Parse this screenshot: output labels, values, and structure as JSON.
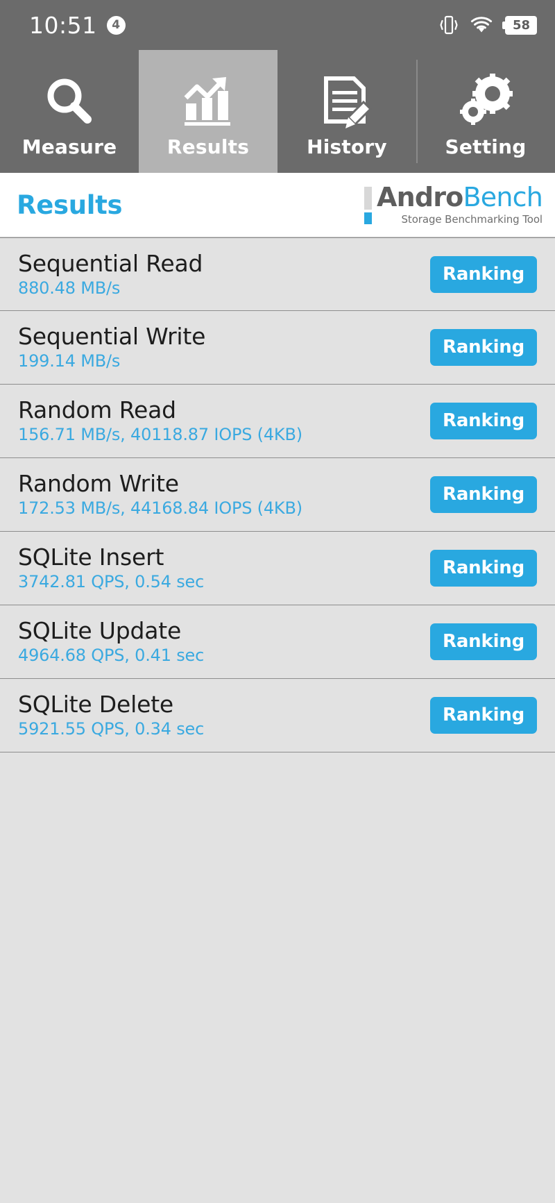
{
  "status_bar": {
    "time": "10:51",
    "notification_count": "4",
    "battery_level": "58",
    "icons": [
      "vibrate-icon",
      "wifi-icon",
      "battery-icon"
    ]
  },
  "tabs": [
    {
      "label": "Measure",
      "icon": "magnifier-icon",
      "active": false
    },
    {
      "label": "Results",
      "icon": "bar-chart-icon",
      "active": true
    },
    {
      "label": "History",
      "icon": "document-pencil-icon",
      "active": false
    },
    {
      "label": "Setting",
      "icon": "gears-icon",
      "active": false
    }
  ],
  "header": {
    "page_title": "Results",
    "brand_primary": "Andro",
    "brand_secondary": "Bench",
    "brand_tagline": "Storage Benchmarking Tool"
  },
  "colors": {
    "accent_blue": "#29a8e0",
    "value_blue": "#3aa9e0",
    "status_bar_gray": "#6b6b6b",
    "active_tab_gray": "#b3b3b3",
    "list_bg": "#e2e2e2"
  },
  "results": [
    {
      "title": "Sequential Read",
      "value": "880.48 MB/s",
      "action": "Ranking"
    },
    {
      "title": "Sequential Write",
      "value": "199.14 MB/s",
      "action": "Ranking"
    },
    {
      "title": "Random Read",
      "value": "156.71 MB/s, 40118.87 IOPS (4KB)",
      "action": "Ranking"
    },
    {
      "title": "Random Write",
      "value": "172.53 MB/s, 44168.84 IOPS (4KB)",
      "action": "Ranking"
    },
    {
      "title": "SQLite Insert",
      "value": "3742.81 QPS, 0.54 sec",
      "action": "Ranking"
    },
    {
      "title": "SQLite Update",
      "value": "4964.68 QPS, 0.41 sec",
      "action": "Ranking"
    },
    {
      "title": "SQLite Delete",
      "value": "5921.55 QPS, 0.34 sec",
      "action": "Ranking"
    }
  ]
}
